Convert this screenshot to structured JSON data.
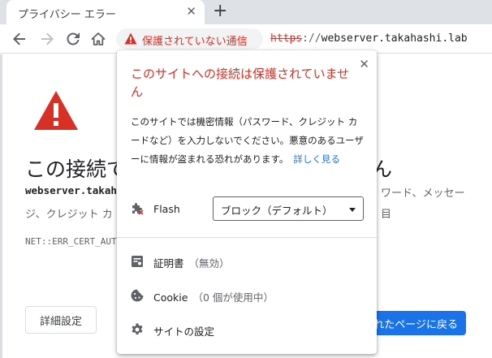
{
  "tab": {
    "title": "プライバシー エラー",
    "close": "✕",
    "new_tab": "+"
  },
  "toolbar": {
    "security_chip": "保護されていない通信",
    "url": {
      "scheme": "https",
      "sep": "://",
      "host": "webserver.takahashi.lab"
    }
  },
  "page": {
    "heading_left": "この接続で",
    "heading_right": "ん",
    "host": "webserver.takahas",
    "line2": "ジ、クレジット カ",
    "right_line1": "ワード、メッセー",
    "right_line2": "目",
    "error_code": "NET::ERR_CERT_AUT",
    "details_button": "詳細設定",
    "back_button": "れたページに戻る"
  },
  "popup": {
    "close": "✕",
    "title": "このサイトへの接続は保護されていません",
    "description": "このサイトでは機密情報（パスワード、クレジット カードなど）を入力しないでください。悪意のあるユーザーに情報が盗まれる恐れがあります。",
    "learn_more": "詳しく見る",
    "flash": {
      "label": "Flash",
      "icon": "puzzle-icon",
      "value": "ブロック（デフォルト）"
    },
    "certificate": {
      "label": "証明書",
      "status": "（無効）",
      "icon": "certificate-icon"
    },
    "cookie": {
      "label": "Cookie",
      "status": "（0 個が使用中）",
      "icon": "cookie-icon"
    },
    "site_settings": {
      "label": "サイトの設定",
      "icon": "gear-icon"
    }
  },
  "colors": {
    "danger": "#d93025",
    "link": "#1a73e8",
    "primary_button": "#1a73e8"
  }
}
